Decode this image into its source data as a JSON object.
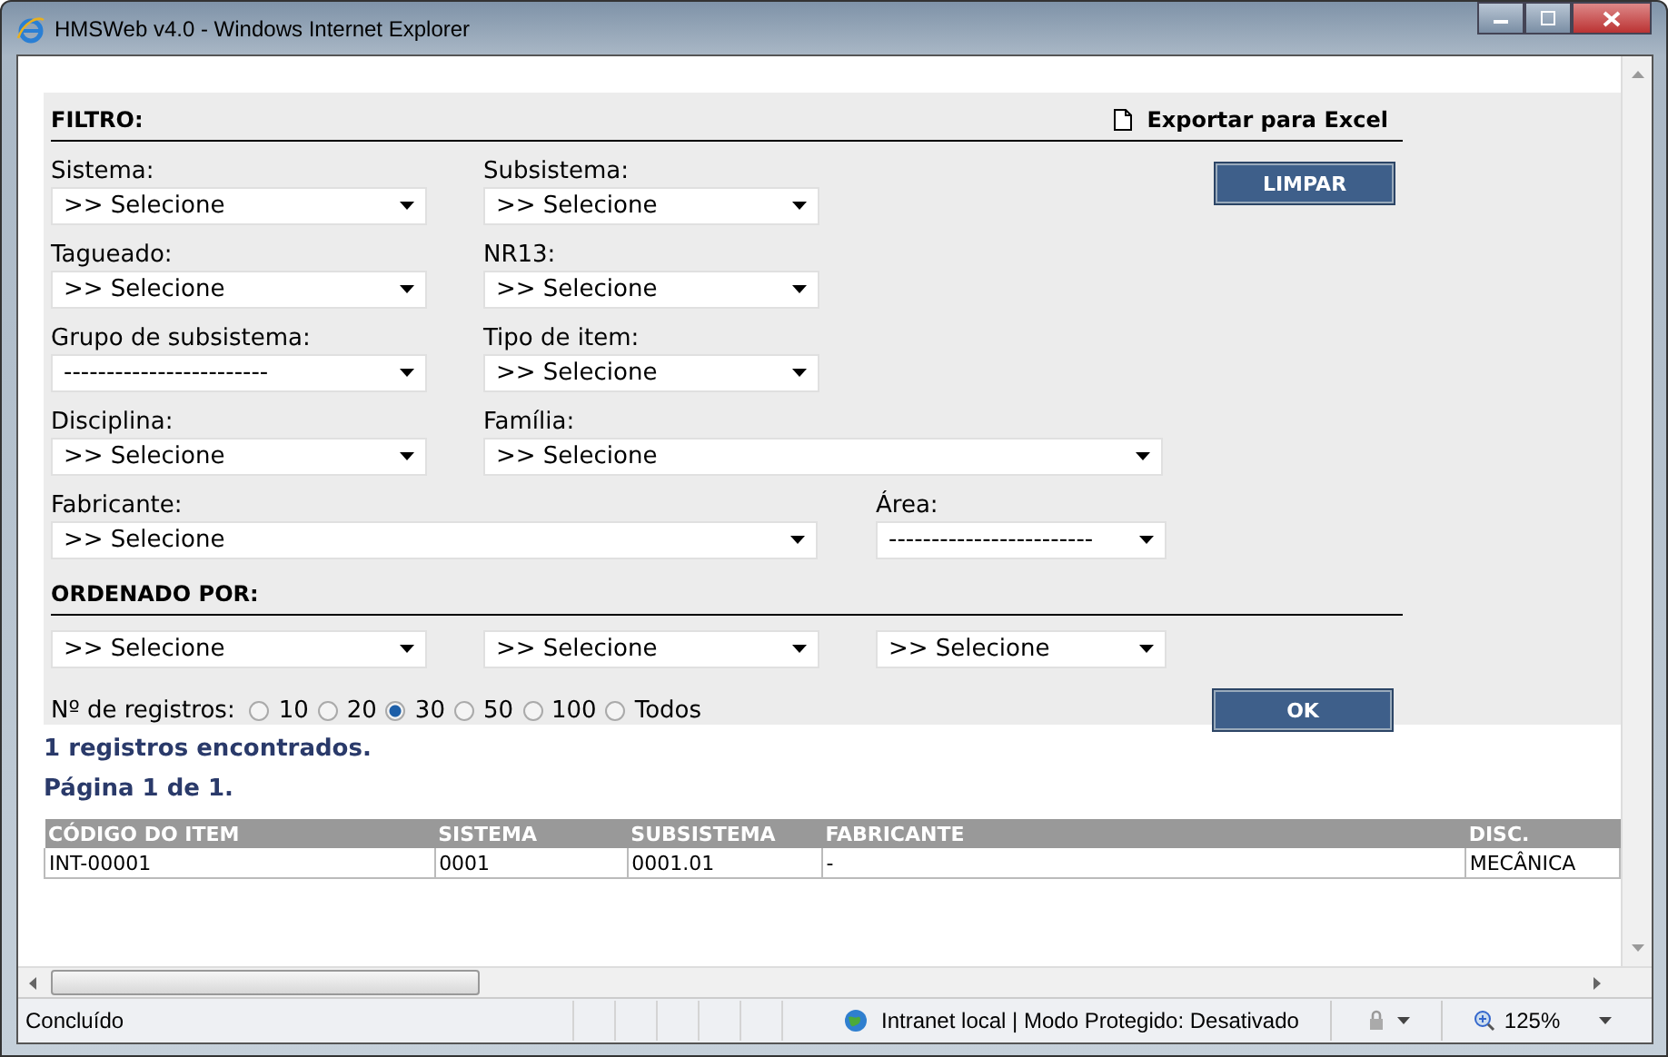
{
  "window": {
    "title": "HMSWeb v4.0 - Windows Internet Explorer"
  },
  "filter": {
    "title": "FILTRO:",
    "export_label": "Exportar para Excel",
    "clear_button": "LIMPAR",
    "rows": [
      [
        {
          "label": "Sistema:",
          "value": ">> Selecione"
        },
        {
          "label": "Subsistema:",
          "value": ">> Selecione"
        }
      ],
      [
        {
          "label": "Tagueado:",
          "value": ">> Selecione"
        },
        {
          "label": "NR13:",
          "value": ">> Selecione"
        }
      ],
      [
        {
          "label": "Grupo de subsistema:",
          "value": "------------------------"
        },
        {
          "label": "Tipo de item:",
          "value": ">> Selecione"
        }
      ],
      [
        {
          "label": "Disciplina:",
          "value": ">> Selecione"
        },
        {
          "label": "Família:",
          "value": ">> Selecione"
        }
      ],
      [
        {
          "label": "Fabricante:",
          "value": ">> Selecione"
        },
        {
          "label": "Área:",
          "value": "------------------------"
        }
      ]
    ]
  },
  "sort": {
    "title": "ORDENADO POR:",
    "selects": [
      ">> Selecione",
      ">> Selecione",
      ">> Selecione"
    ]
  },
  "records": {
    "label": "Nº de registros:",
    "options": [
      {
        "label": "10",
        "selected": false
      },
      {
        "label": "20",
        "selected": false
      },
      {
        "label": "30",
        "selected": true
      },
      {
        "label": "50",
        "selected": false
      },
      {
        "label": "100",
        "selected": false
      },
      {
        "label": "Todos",
        "selected": false
      }
    ],
    "ok_button": "OK"
  },
  "results": {
    "count": "1 registros encontrados.",
    "page": "Página 1 de 1."
  },
  "table": {
    "columns": [
      "CÓDIGO DO ITEM",
      "SISTEMA",
      "SUBSISTEMA",
      "FABRICANTE",
      "DISC."
    ],
    "rows": [
      [
        "INT-00001",
        "0001",
        "0001.01",
        "-",
        "MECÂNICA"
      ]
    ]
  },
  "status_bar": {
    "status": "Concluído",
    "zone": "Intranet local | Modo Protegido: Desativado",
    "zoom": "125%"
  }
}
